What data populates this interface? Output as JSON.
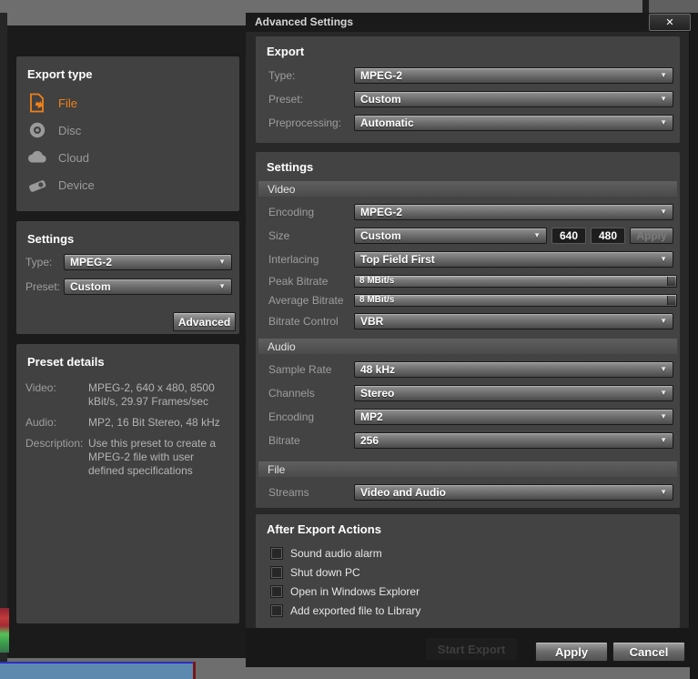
{
  "colors": {
    "accent_orange": "#f08018",
    "panel_gray": "#434343",
    "window_dark": "#1b1b1b",
    "dialog_bg": "#282828",
    "timeline_blue": "#5d89af",
    "timeline_marker_red": "#7a1516"
  },
  "background_window": {
    "export_type": {
      "title": "Export type",
      "items": [
        {
          "label": "File",
          "icon": "file-export-icon",
          "selected": true
        },
        {
          "label": "Disc",
          "icon": "disc-icon",
          "selected": false
        },
        {
          "label": "Cloud",
          "icon": "cloud-icon",
          "selected": false
        },
        {
          "label": "Device",
          "icon": "device-icon",
          "selected": false
        }
      ]
    },
    "settings": {
      "title": "Settings",
      "type_label": "Type:",
      "type_value": "MPEG-2",
      "preset_label": "Preset:",
      "preset_value": "Custom",
      "advanced_button": "Advanced"
    },
    "preset_details": {
      "title": "Preset details",
      "video_label": "Video:",
      "video_value": "MPEG-2, 640 x 480, 8500 kBit/s, 29.97 Frames/sec",
      "audio_label": "Audio:",
      "audio_value": "MP2, 16 Bit Stereo, 48 kHz",
      "description_label": "Description:",
      "description_value": "Use this preset to create a MPEG-2 file with user defined specifications"
    },
    "start_export_button": "Start Export"
  },
  "dialog": {
    "title": "Advanced Settings",
    "close_icon": "✕",
    "export": {
      "title": "Export",
      "type_label": "Type:",
      "type_value": "MPEG-2",
      "preset_label": "Preset:",
      "preset_value": "Custom",
      "preprocessing_label": "Preprocessing:",
      "preprocessing_value": "Automatic"
    },
    "settings": {
      "title": "Settings",
      "video": {
        "header": "Video",
        "encoding_label": "Encoding",
        "encoding_value": "MPEG-2",
        "size_label": "Size",
        "size_value": "Custom",
        "size_width": "640",
        "size_height": "480",
        "size_apply": "Apply",
        "interlacing_label": "Interlacing",
        "interlacing_value": "Top Field First",
        "peak_bitrate_label": "Peak Bitrate",
        "peak_bitrate_value": "8 MBit/s",
        "average_bitrate_label": "Average Bitrate",
        "average_bitrate_value": "8 MBit/s",
        "bitrate_control_label": "Bitrate Control",
        "bitrate_control_value": "VBR"
      },
      "audio": {
        "header": "Audio",
        "sample_rate_label": "Sample Rate",
        "sample_rate_value": "48 kHz",
        "channels_label": "Channels",
        "channels_value": "Stereo",
        "encoding_label": "Encoding",
        "encoding_value": "MP2",
        "bitrate_label": "Bitrate",
        "bitrate_value": "256"
      },
      "file": {
        "header": "File",
        "streams_label": "Streams",
        "streams_value": "Video and Audio"
      }
    },
    "after_export": {
      "title": "After Export Actions",
      "checkboxes": [
        {
          "label": "Sound audio alarm",
          "checked": false
        },
        {
          "label": "Shut down PC",
          "checked": false
        },
        {
          "label": "Open in Windows Explorer",
          "checked": false
        },
        {
          "label": "Add exported file to Library",
          "checked": false
        }
      ]
    },
    "footer": {
      "apply_button": "Apply",
      "cancel_button": "Cancel"
    }
  }
}
